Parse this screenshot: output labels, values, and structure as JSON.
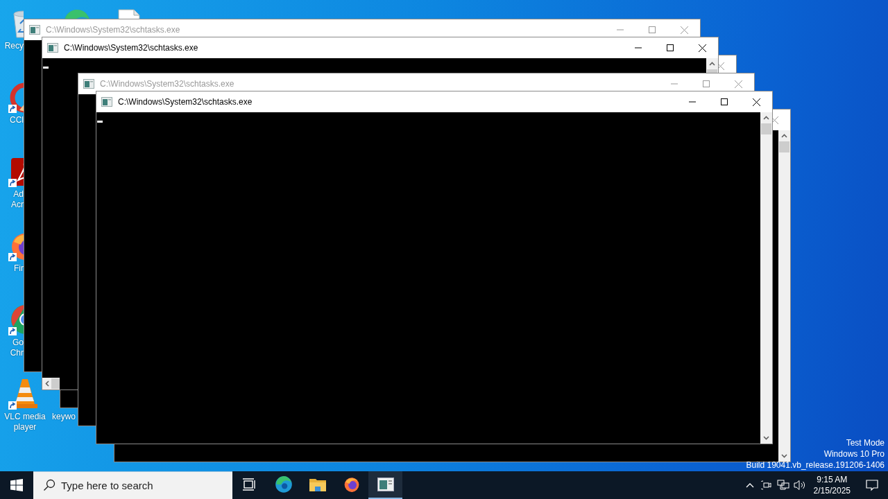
{
  "desktop_icons": [
    {
      "kind": "recycle",
      "label": [
        "Recy"
      ],
      "cut": true,
      "shortcut": false
    },
    {
      "kind": "edge"
    },
    {
      "kind": "file"
    },
    {
      "kind": "ccleaner",
      "label": [
        "CCl"
      ],
      "cut": true,
      "shortcut": true
    },
    {
      "kind": "acrobat",
      "label": [
        "Ad",
        "Acr"
      ],
      "cut": true,
      "shortcut": true
    },
    {
      "kind": "firefox",
      "label": [
        "Fir"
      ],
      "cut": true,
      "shortcut": true
    },
    {
      "kind": "chrome",
      "label": [
        "Go",
        "Chr"
      ],
      "cut": true,
      "shortcut": true
    },
    {
      "kind": "vlc",
      "label": [
        "VLC media",
        "player"
      ],
      "cut": false,
      "shortcut": true
    },
    {
      "label": [
        "keywo"
      ],
      "cut": true
    }
  ],
  "windows": [
    {
      "title": "C:\\Windows\\System32\\schtasks.exe",
      "active": false,
      "kind": "full"
    },
    {
      "title": "C:\\Windows\\System32\\schtasks.exe",
      "active": true,
      "kind": "full",
      "parts": [
        {
          "kind": "cursor"
        },
        {
          "kind": "vscroll"
        },
        {
          "kind": "hscroll"
        }
      ]
    },
    {
      "active": false,
      "kind": "close-only"
    },
    {
      "title": "C:\\Windows\\System32\\schtasks.exe",
      "active": false,
      "kind": "full"
    },
    {
      "title": "C:\\Windows\\System32\\schtasks.exe",
      "active": true,
      "kind": "full",
      "parts": [
        {
          "kind": "cursor"
        },
        {
          "kind": "vscroll"
        }
      ]
    },
    {
      "active": false,
      "kind": "close-only",
      "parts": [
        {
          "kind": "vscroll"
        }
      ]
    }
  ],
  "watermark": [
    "Test Mode",
    "Windows 10 Pro",
    "Build 19041.vb_release.191206-1406"
  ],
  "taskbar": {
    "search": {
      "placeholder": "Type here to search"
    },
    "apps": [
      {
        "kind": "task-view",
        "selected": false
      },
      {
        "kind": "edge",
        "selected": false
      },
      {
        "kind": "explorer",
        "selected": false
      },
      {
        "kind": "firefox",
        "selected": false
      },
      {
        "kind": "console",
        "selected": true
      }
    ],
    "tray": {
      "time": "9:15 AM",
      "date": "2/15/2025"
    }
  }
}
